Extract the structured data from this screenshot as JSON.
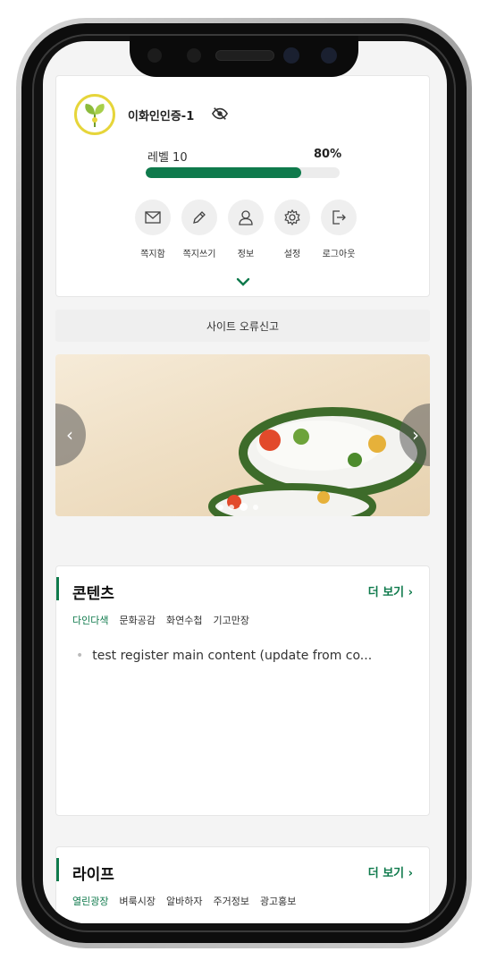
{
  "profile": {
    "username": "이화인인증-1",
    "level_label": "레벨 10",
    "level_percent_label": "80%",
    "level_progress": 0.8
  },
  "menu": {
    "items": [
      {
        "label": "쪽지함",
        "icon": "mail-icon"
      },
      {
        "label": "쪽지쓰기",
        "icon": "pencil-icon"
      },
      {
        "label": "정보",
        "icon": "user-icon"
      },
      {
        "label": "설정",
        "icon": "gear-icon"
      },
      {
        "label": "로그아웃",
        "icon": "logout-icon"
      }
    ]
  },
  "report": {
    "label": "사이트 오류신고"
  },
  "carousel": {
    "prev": "‹",
    "next": "›",
    "slide_count": 4,
    "active_index": 2
  },
  "sections": {
    "contents": {
      "title": "콘텐츠",
      "more": "더 보기 ›",
      "tabs": [
        "다인다색",
        "문화공감",
        "화연수첩",
        "기고만장"
      ],
      "active_tab": 0,
      "posts": [
        "test register main content (update from co..."
      ]
    },
    "life": {
      "title": "라이프",
      "more": "더 보기 ›",
      "tabs": [
        "열린광장",
        "벼룩시장",
        "알바하자",
        "주거정보",
        "광고홍보"
      ],
      "active_tab": 0
    }
  },
  "colors": {
    "accent": "#0f7a4c",
    "avatar_ring": "#e6d53a"
  }
}
